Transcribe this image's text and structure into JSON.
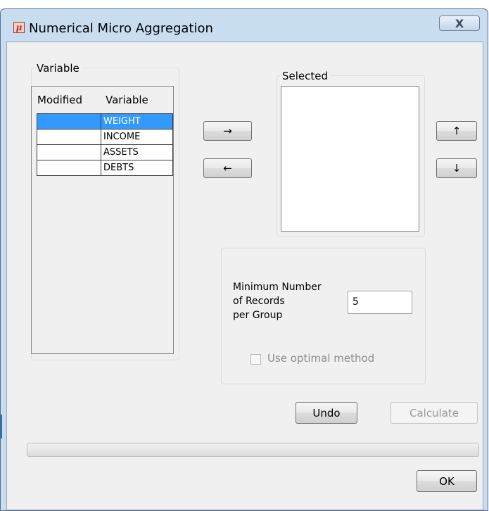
{
  "window": {
    "title": "Numerical Micro Aggregation",
    "app_icon_glyph": "μ",
    "close_glyph": "X"
  },
  "variable_group": {
    "legend": "Variable",
    "columns": [
      "Modified",
      "Variable"
    ],
    "rows": [
      {
        "modified": "",
        "variable": "WEIGHT",
        "selected": true
      },
      {
        "modified": "",
        "variable": "INCOME",
        "selected": false
      },
      {
        "modified": "",
        "variable": "ASSETS",
        "selected": false
      },
      {
        "modified": "",
        "variable": "DEBTS",
        "selected": false
      }
    ]
  },
  "transfer": {
    "add_glyph": "→",
    "remove_glyph": "←"
  },
  "selected_group": {
    "legend": "Selected",
    "items": []
  },
  "order": {
    "up_glyph": "↑",
    "down_glyph": "↓"
  },
  "options": {
    "min_records_label_1": "Minimum Number",
    "min_records_label_2": "of Records",
    "min_records_label_3": "per Group",
    "min_records_value": "5",
    "optimal_label": "Use optimal method",
    "optimal_checked": false,
    "optimal_enabled": false
  },
  "buttons": {
    "undo": "Undo",
    "calculate": "Calculate",
    "ok": "OK"
  },
  "progress": {
    "value": 0
  },
  "colors": {
    "selection": "#3399ff",
    "titlebar": "#c9ddf1"
  }
}
